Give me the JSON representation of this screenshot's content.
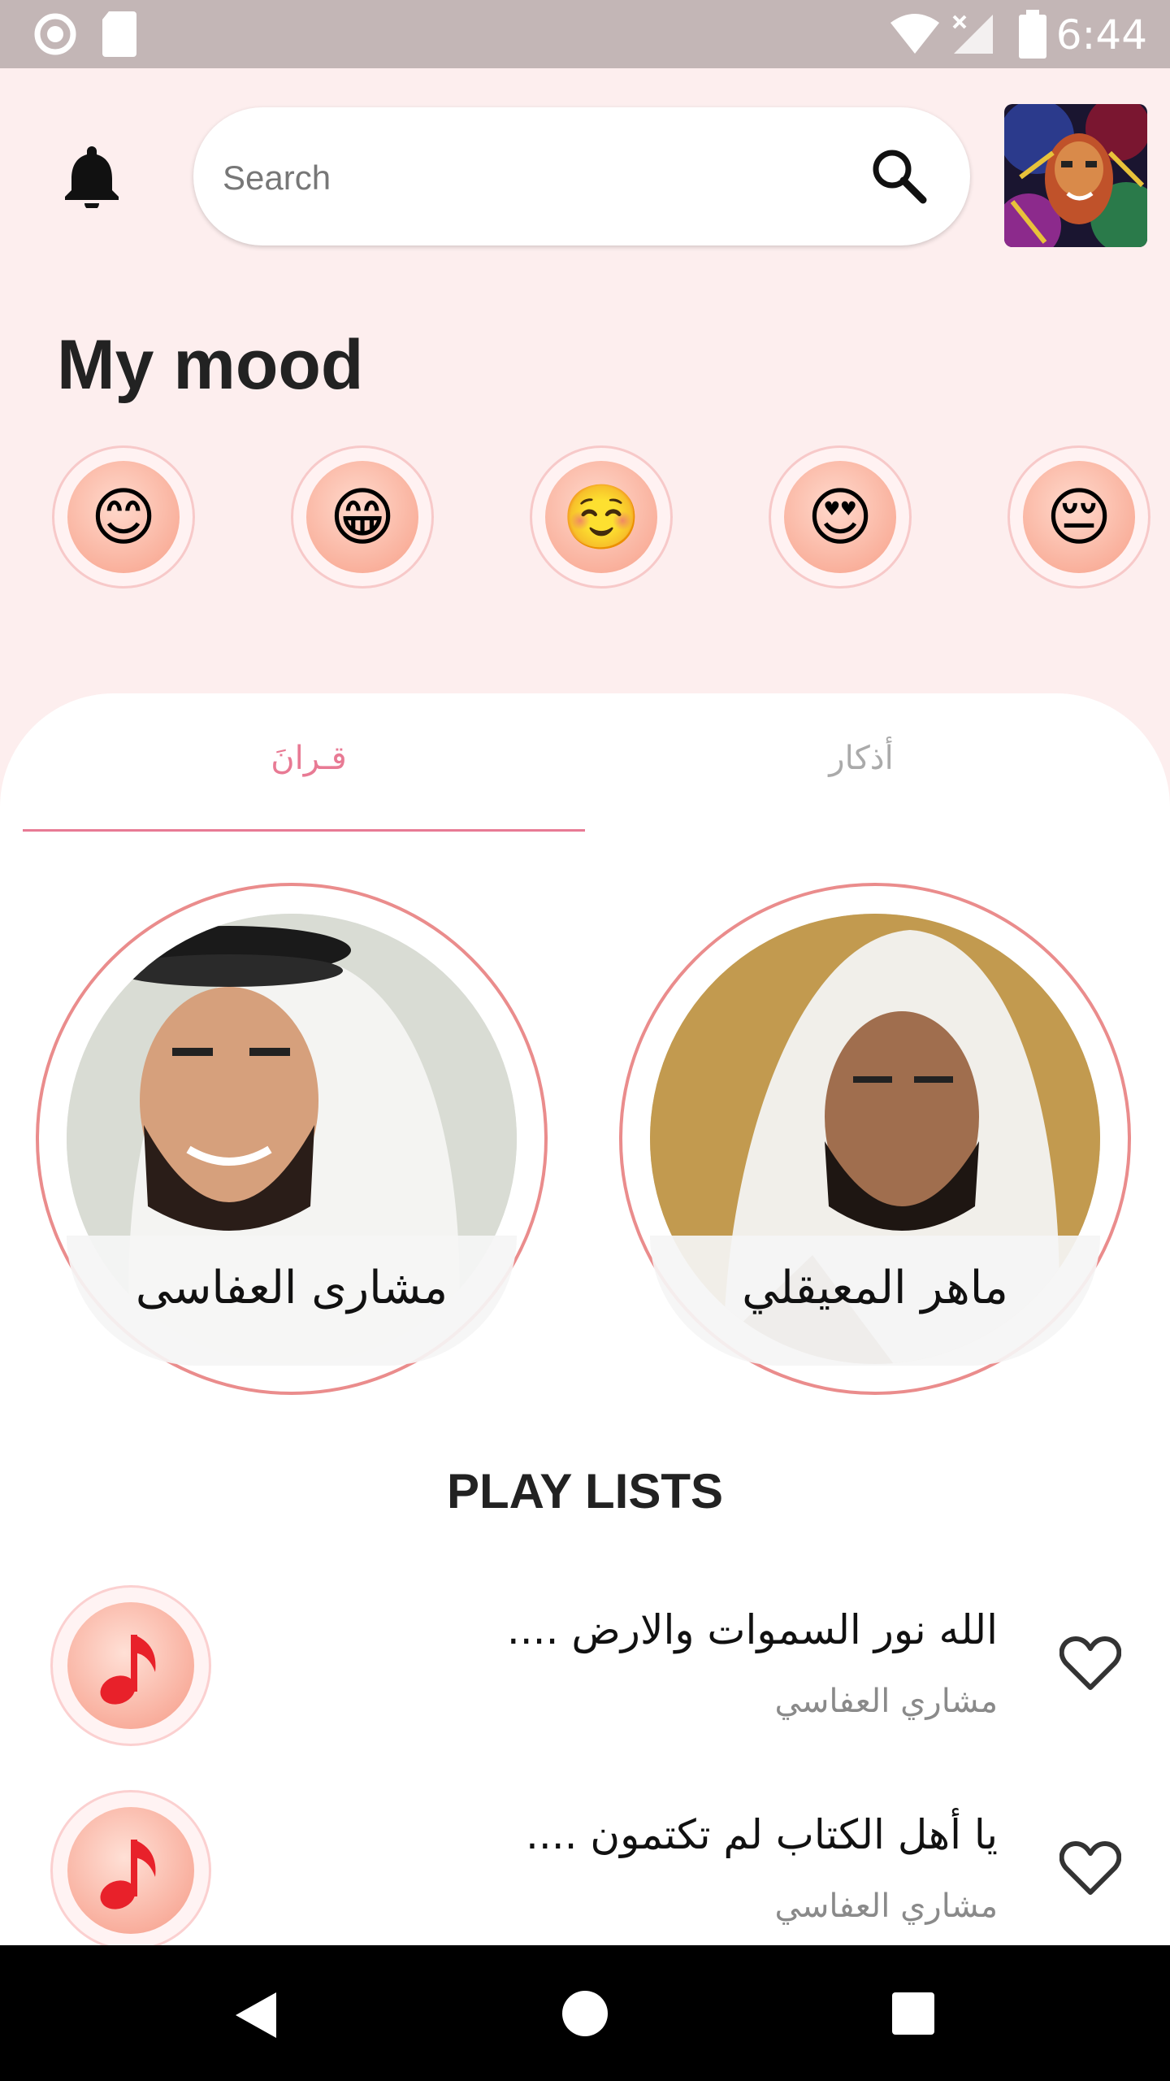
{
  "status_bar": {
    "time": "6:44"
  },
  "header": {
    "search_placeholder": "Search"
  },
  "mood": {
    "title": "My mood",
    "emojis": [
      "😊",
      "😁",
      "☺️",
      "😍",
      "😔"
    ]
  },
  "tabs": {
    "quran": "قـرانَ",
    "azkar": "أذكار"
  },
  "reciters": [
    {
      "name": "مشارى العفاسى"
    },
    {
      "name": "ماهر المعيقلي"
    }
  ],
  "playlists": {
    "title": "PLAY LISTS",
    "items": [
      {
        "title": "الله نور السموات والارض ....",
        "reciter": "مشاري العفاسي"
      },
      {
        "title": "يا أهل الكتاب لم تكتمون ....",
        "reciter": "مشاري العفاسي"
      }
    ]
  },
  "colors": {
    "accent": "#e87a94",
    "background": "#fdeeee",
    "note": "#e8212a"
  }
}
